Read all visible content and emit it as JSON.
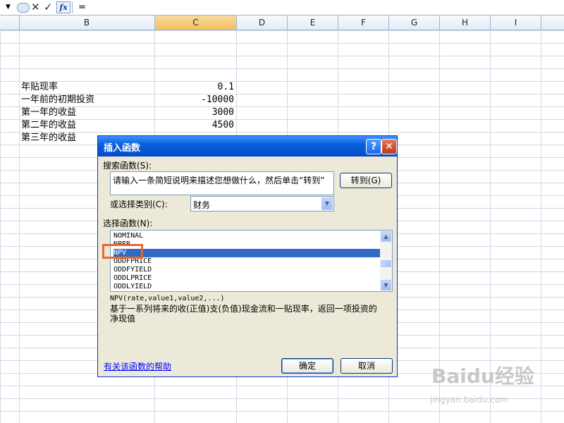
{
  "formula_bar": {
    "content": "="
  },
  "columns": [
    "B",
    "C",
    "D",
    "E",
    "F",
    "G",
    "H",
    "I"
  ],
  "cells": [
    {
      "label": "年贴现率",
      "value": "0.1"
    },
    {
      "label": "一年前的初期投资",
      "value": "-10000"
    },
    {
      "label": "第一年的收益",
      "value": "3000"
    },
    {
      "label": "第二年的收益",
      "value": "4500"
    },
    {
      "label": "第三年的收益",
      "value": ""
    }
  ],
  "dialog": {
    "title": "插入函数",
    "search_label": "搜索函数(S):",
    "search_text": "请输入一条简短说明来描述您想做什么，然后单击“转到”",
    "go_button": "转到(G)",
    "category_label": "或选择类别(C):",
    "category_value": "财务",
    "select_label": "选择函数(N):",
    "functions": [
      "NOMINAL",
      "NPER",
      "NPV",
      "ODDFPRICE",
      "ODDFYIELD",
      "ODDLPRICE",
      "ODDLYIELD"
    ],
    "selected_function": "NPV",
    "syntax": "NPV(rate,value1,value2,...)",
    "description": "基于一系列将来的收(正值)支(负值)现金流和一贴现率，返回一项投资的净现值",
    "help_link": "有关该函数的帮助",
    "ok_button": "确定",
    "cancel_button": "取消"
  },
  "watermark": {
    "brand": "Baidu经验",
    "url": "jingyan.baidu.com"
  }
}
